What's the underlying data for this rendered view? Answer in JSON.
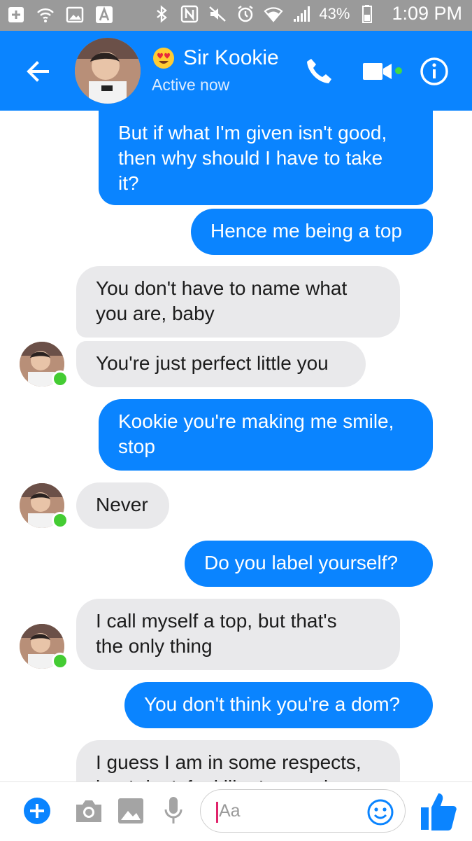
{
  "status_bar": {
    "battery": "43%",
    "time": "1:09 PM"
  },
  "header": {
    "contact_name": "Sir Kookie",
    "status": "Active now"
  },
  "messages": [
    {
      "side": "sent",
      "text": "But if what I'm given isn't good,\nthen why should I have to take\nit?"
    },
    {
      "side": "sent",
      "text": "Hence me being a top"
    },
    {
      "side": "recv",
      "text": "You don't have to name what\nyou are, baby"
    },
    {
      "side": "recv",
      "text": "You're just perfect little you"
    },
    {
      "side": "sent",
      "text": "Kookie you're making me smile,\nstop"
    },
    {
      "side": "recv",
      "text": "Never"
    },
    {
      "side": "sent",
      "text": "Do you label yourself?"
    },
    {
      "side": "recv",
      "text": "I call myself a top, but that's\nthe only thing"
    },
    {
      "side": "sent",
      "text": "You don't think you're a dom?"
    },
    {
      "side": "recv",
      "text": "I guess I am in some respects,\nbut I don't feel like I am strict"
    }
  ],
  "composer": {
    "placeholder": "Aa"
  },
  "colors": {
    "accent": "#0a84ff",
    "received_bubble": "#e9e9eb",
    "status_bar": "#9a9a9a",
    "online": "#44cc33"
  }
}
